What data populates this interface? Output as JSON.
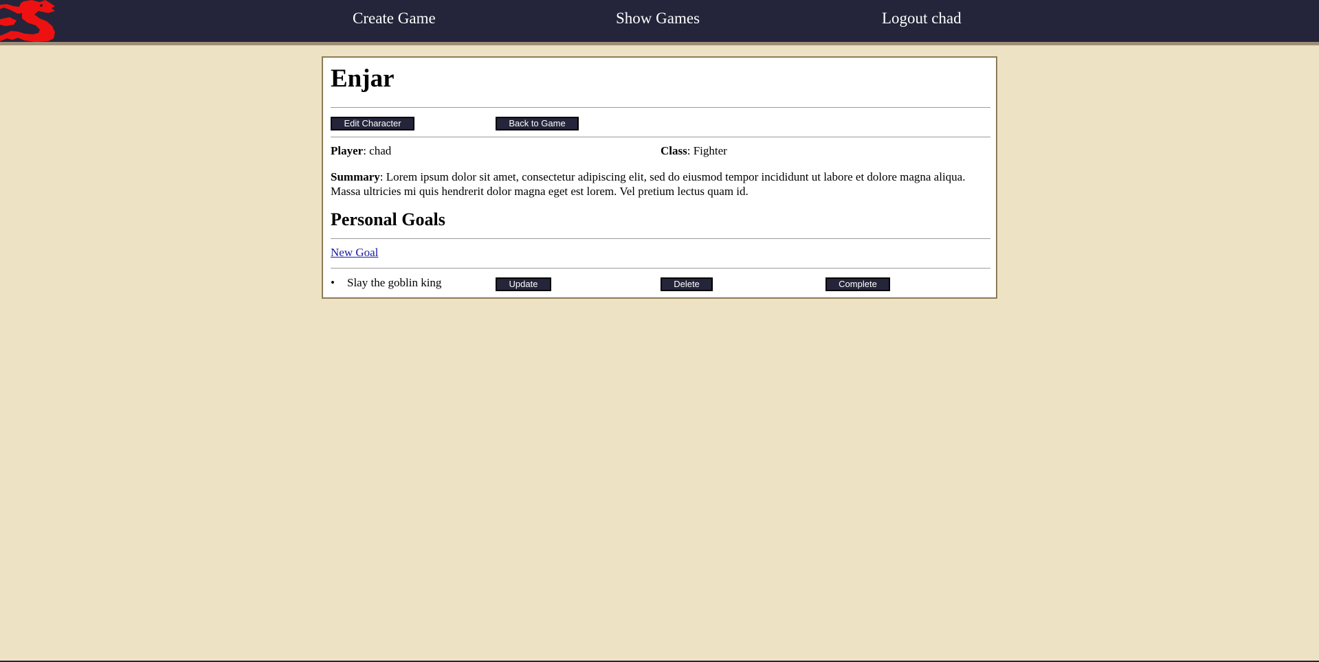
{
  "nav": {
    "create_game": "Create Game",
    "show_games": "Show Games",
    "logout": "Logout chad"
  },
  "character": {
    "name": "Enjar",
    "edit_label": "Edit Character",
    "back_label": "Back to Game",
    "player_label": "Player",
    "player_value": ": chad",
    "class_label": "Class",
    "class_value": ": Fighter",
    "summary_label": "Summary",
    "summary_value": ": Lorem ipsum dolor sit amet, consectetur adipiscing elit, sed do eiusmod tempor incididunt ut labore et dolore magna aliqua. Massa ultricies mi quis hendrerit dolor magna eget est lorem. Vel pretium lectus quam id."
  },
  "goals": {
    "title": "Personal Goals",
    "new_goal_label": "New Goal",
    "items": [
      {
        "text": "Slay the goblin king",
        "update_label": "Update",
        "delete_label": "Delete",
        "complete_label": "Complete"
      }
    ]
  },
  "icons": {
    "logo": "red-dragon-logo-icon"
  },
  "colors": {
    "navbar": "#24253a",
    "navbar_border": "#a08f78",
    "page_background": "#ede3c4",
    "card_border": "#8d7a55",
    "button": "#24253a",
    "logo": "#ee1111",
    "link": "#1a1aa6"
  }
}
